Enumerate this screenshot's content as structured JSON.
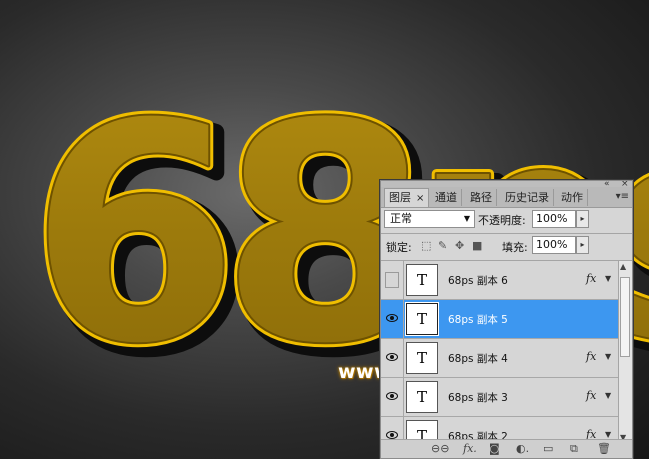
{
  "artwork": {
    "text": "68ps",
    "watermark": "www.68ps.com",
    "colors": {
      "gold": "#b08a12",
      "gold_edge": "#f2c200",
      "shadow": "#111111"
    }
  },
  "panel": {
    "tabs": [
      {
        "label": "图层",
        "active": true,
        "close": "×"
      },
      {
        "label": "通道"
      },
      {
        "label": "路径"
      },
      {
        "label": "历史记录"
      },
      {
        "label": "动作"
      }
    ],
    "menu_icon": "panel-menu-icon",
    "collapse_icon": "«",
    "close_icon": "×",
    "blend_mode": "正常",
    "opacity_label": "不透明度:",
    "opacity_value": "100%",
    "lock_label": "锁定:",
    "fill_label": "填充:",
    "fill_value": "100%",
    "layers": [
      {
        "name": "68ps 副本 6",
        "visible": false,
        "selected": false,
        "thumb": "T",
        "fx": "fx"
      },
      {
        "name": "68ps 副本 5",
        "visible": true,
        "selected": true,
        "thumb": "T",
        "fx": ""
      },
      {
        "name": "68ps 副本 4",
        "visible": true,
        "selected": false,
        "thumb": "T",
        "fx": "fx"
      },
      {
        "name": "68ps 副本 3",
        "visible": true,
        "selected": false,
        "thumb": "T",
        "fx": "fx"
      },
      {
        "name": "68ps 副本 2",
        "visible": true,
        "selected": false,
        "thumb": "T",
        "fx": "fx"
      }
    ],
    "footer_icons": [
      "link-icon",
      "fx-icon",
      "mask-icon",
      "adjustment-icon",
      "group-icon",
      "new-layer-icon",
      "trash-icon"
    ]
  }
}
